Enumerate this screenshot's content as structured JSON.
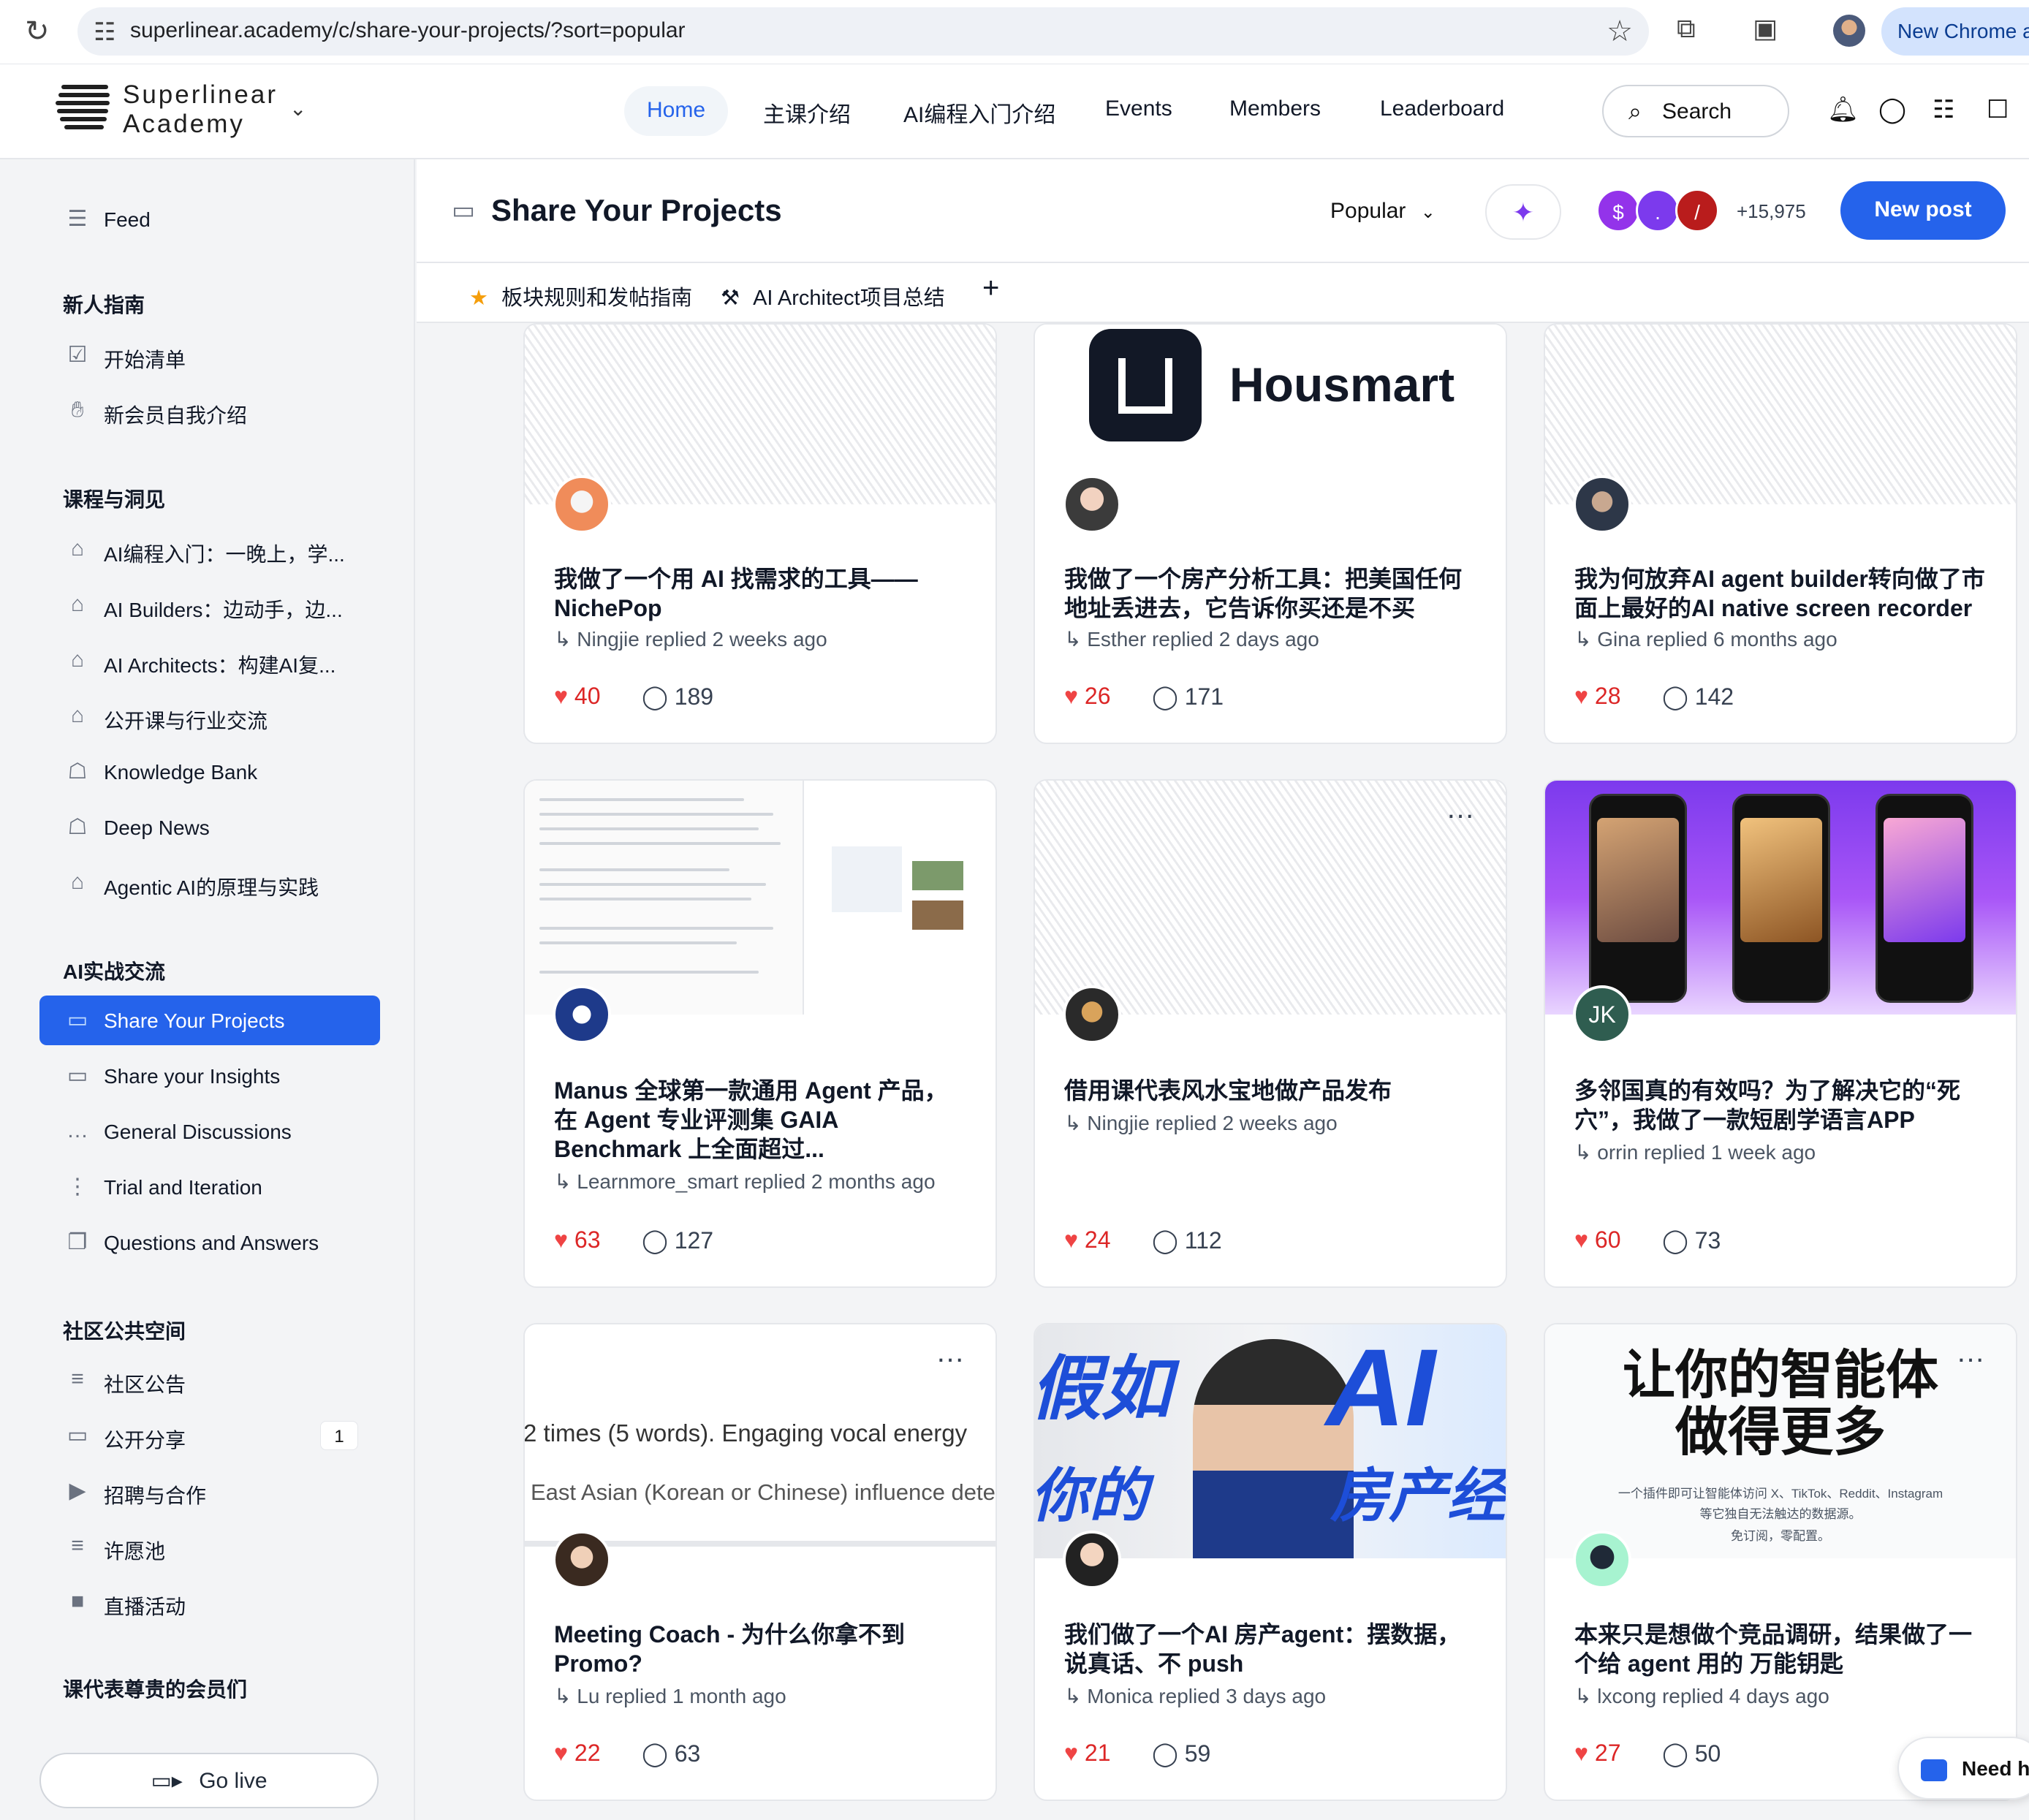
{
  "browser": {
    "url": "superlinear.academy/c/share-your-projects/?sort=popular",
    "new_chrome_label": "New Chrome a"
  },
  "brand": {
    "line1": "Superlinear",
    "line2": "Academy"
  },
  "nav": {
    "home": "Home",
    "items": [
      "主课介绍",
      "AI编程入门介绍",
      "Events",
      "Members",
      "Leaderboard"
    ],
    "search": "Search"
  },
  "sidebar": {
    "feed": "Feed",
    "sections": [
      {
        "title": "新人指南",
        "items": [
          {
            "label": "开始清单",
            "icon": "checkbox-icon"
          },
          {
            "label": "新会员自我介绍",
            "icon": "wave-icon"
          }
        ]
      },
      {
        "title": "课程与洞见",
        "items": [
          {
            "label": "AI编程入门：一晚上，学...",
            "icon": "graduation-cap-icon"
          },
          {
            "label": "AI Builders：边动手，边...",
            "icon": "graduation-cap-icon"
          },
          {
            "label": "AI Architects：构建AI复...",
            "icon": "graduation-cap-icon"
          },
          {
            "label": "公开课与行业交流",
            "icon": "graduation-cap-icon"
          },
          {
            "label": "Knowledge Bank",
            "icon": "bank-icon"
          },
          {
            "label": "Deep News",
            "icon": "bank-icon"
          },
          {
            "label": "Agentic AI的原理与实践",
            "icon": "graduation-cap-icon"
          }
        ]
      },
      {
        "title": "AI实战交流",
        "items": [
          {
            "label": "Share Your Projects",
            "icon": "presentation-icon",
            "active": true
          },
          {
            "label": "Share your Insights",
            "icon": "presentation-icon"
          },
          {
            "label": "General Discussions",
            "icon": "chat-icon"
          },
          {
            "label": "Trial and Iteration",
            "icon": "flow-icon"
          },
          {
            "label": "Questions and Answers",
            "icon": "qa-icon"
          }
        ]
      },
      {
        "title": "社区公共空间",
        "items": [
          {
            "label": "社区公告",
            "icon": "list-icon"
          },
          {
            "label": "公开分享",
            "icon": "presentation-icon",
            "badge": "1"
          },
          {
            "label": "招聘与合作",
            "icon": "megaphone-icon"
          },
          {
            "label": "许愿池",
            "icon": "list-icon"
          },
          {
            "label": "直播活动",
            "icon": "video-icon"
          }
        ]
      },
      {
        "title": "课代表尊贵的会员们",
        "items": []
      }
    ],
    "go_live": "Go live"
  },
  "main": {
    "title": "Share Your Projects",
    "sort": "Popular",
    "member_avatars": [
      "$",
      ".",
      "/"
    ],
    "member_count": "+15,975",
    "new_post": "New post",
    "tabs": [
      "板块规则和发帖指南",
      "AI Architect项目总结"
    ]
  },
  "cards": [
    {
      "title": "我做了一个用 AI 找需求的工具——NichePop",
      "meta": "Ningjie replied 2 weeks ago",
      "likes": "40",
      "comments": "189"
    },
    {
      "title": "我做了一个房产分析工具：把美国任何地址丢进去，它告诉你买还是不买",
      "meta": "Esther replied 2 days ago",
      "likes": "26",
      "comments": "171",
      "cover_text": "Housmart"
    },
    {
      "title": "我为何放弃AI agent builder转向做了市面上最好的AI native screen recorder",
      "meta": "Gina replied 6 months ago",
      "likes": "28",
      "comments": "142"
    },
    {
      "title": "Manus 全球第一款通用 Agent 产品，在 Agent 专业评测集 GAIA Benchmark 上全面超过...",
      "meta": "Learnmore_smart replied 2 months ago",
      "likes": "63",
      "comments": "127"
    },
    {
      "title": "借用课代表风水宝地做产品发布",
      "meta": "Ningjie replied 2 weeks ago",
      "likes": "24",
      "comments": "112"
    },
    {
      "title": "多邻国真的有效吗？为了解决它的“死穴”，我做了一款短剧学语言APP",
      "meta": "orrin replied 1 week ago",
      "likes": "60",
      "comments": "73",
      "avatar_text": "JK"
    },
    {
      "title": "Meeting Coach - 为什么你拿不到Promo?",
      "meta": "Lu replied 1 month ago",
      "likes": "22",
      "comments": "63",
      "cover_line1": "2 times (5 words). Engaging vocal energy",
      "cover_line2": "East Asian (Korean or Chinese) influence dete"
    },
    {
      "title": "我们做了一个AI 房产agent：摆数据，说真话、不 push",
      "meta": "Monica replied 3 days ago",
      "likes": "21",
      "comments": "59",
      "cover_left_top": "假如",
      "cover_left_bottom": "你的",
      "cover_right_top": "AI",
      "cover_right_bottom": "房产经"
    },
    {
      "title": "本来只是想做个竞品调研，结果做了一个给 agent 用的 万能钥匙",
      "meta": "lxcong replied 4 days ago",
      "likes": "27",
      "comments": "50",
      "cover_h1": "让你的智能体",
      "cover_h2": "做得更多",
      "cover_s1": "一个插件即可让智能体访问 X、TikTok、Reddit、Instagram",
      "cover_s2": "等它独自无法触达的数据源。",
      "cover_s3": "免订阅，零配置。"
    }
  ],
  "need_help": "Need h",
  "colors": {
    "accent": "#2563eb",
    "like": "#ef4444"
  }
}
